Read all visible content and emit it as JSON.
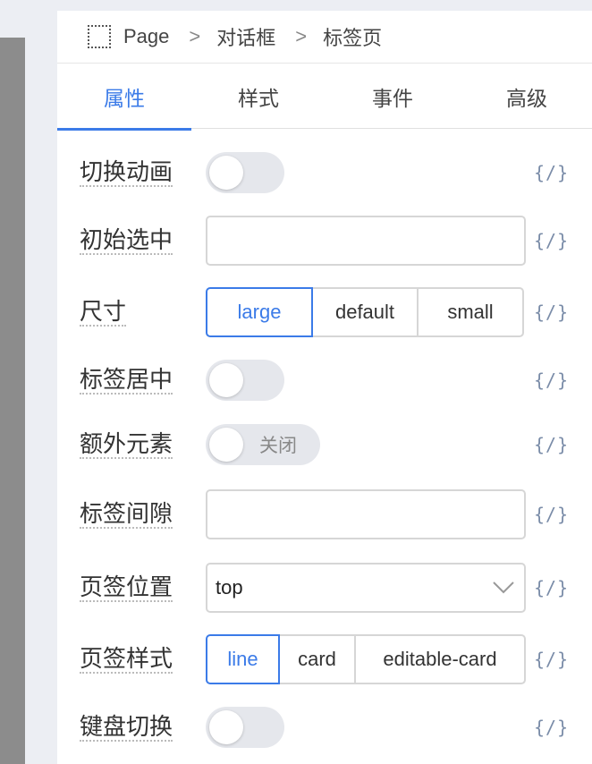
{
  "breadcrumb": {
    "items": [
      "Page",
      "对话框",
      "标签页"
    ],
    "separator": ">"
  },
  "tabs": [
    {
      "label": "属性",
      "active": true
    },
    {
      "label": "样式",
      "active": false
    },
    {
      "label": "事件",
      "active": false
    },
    {
      "label": "高级",
      "active": false
    }
  ],
  "code_icon": "{/}",
  "properties": {
    "switch_animation": {
      "label": "切换动画",
      "value": false
    },
    "initial_selected": {
      "label": "初始选中",
      "value": ""
    },
    "size": {
      "label": "尺寸",
      "options": [
        "large",
        "default",
        "small"
      ],
      "selected": "large"
    },
    "label_centered": {
      "label": "标签居中",
      "value": false
    },
    "extra_element": {
      "label": "额外元素",
      "value": false,
      "state_text": "关闭"
    },
    "label_gap": {
      "label": "标签间隙",
      "value": ""
    },
    "tab_position": {
      "label": "页签位置",
      "value": "top"
    },
    "tab_style": {
      "label": "页签样式",
      "options": [
        "line",
        "card",
        "editable-card"
      ],
      "selected": "line"
    },
    "keyboard_switch": {
      "label": "键盘切换",
      "value": false
    }
  },
  "colors": {
    "accent": "#3b7be8",
    "background": "#eceef3",
    "switch_off": "#e5e7ec"
  }
}
